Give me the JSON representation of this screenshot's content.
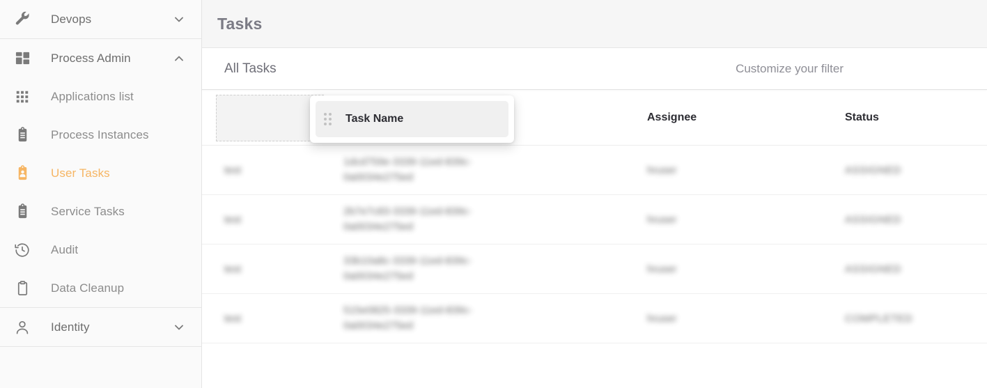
{
  "sidebar": {
    "groups": [
      {
        "label": "Devops",
        "icon": "wrench-icon",
        "expanded": false,
        "chevron": "chevron-down-icon",
        "items": []
      },
      {
        "label": "Process Admin",
        "icon": "dashboard-grid-icon",
        "expanded": true,
        "chevron": "chevron-up-icon",
        "items": [
          {
            "label": "Applications list",
            "icon": "apps-grid-icon",
            "active": false
          },
          {
            "label": "Process Instances",
            "icon": "clipboard-list-icon",
            "active": false
          },
          {
            "label": "User Tasks",
            "icon": "user-task-icon",
            "active": true
          },
          {
            "label": "Service Tasks",
            "icon": "clipboard-list-icon",
            "active": false
          },
          {
            "label": "Audit",
            "icon": "history-clock-icon",
            "active": false
          },
          {
            "label": "Data Cleanup",
            "icon": "clipboard-icon",
            "active": false
          }
        ]
      },
      {
        "label": "Identity",
        "icon": "person-icon",
        "expanded": false,
        "chevron": "chevron-down-icon",
        "items": []
      }
    ]
  },
  "header": {
    "title": "Tasks"
  },
  "filter_bar": {
    "title": "All Tasks",
    "customize_link": "Customize your filter"
  },
  "drag_card": {
    "label": "Task Name",
    "handle_icon": "drag-handle-dots-icon"
  },
  "table": {
    "columns": [
      {
        "key": "dropzone",
        "label": ""
      },
      {
        "key": "name",
        "label": ""
      },
      {
        "key": "assignee",
        "label": "Assignee"
      },
      {
        "key": "status",
        "label": "Status"
      }
    ],
    "rows": [
      {
        "first": "test",
        "name_line1": "1dcd759e-3339-11ed-839c-",
        "name_line2": "0a0034e275ed",
        "assignee": "hruser",
        "status": "ASSIGNED"
      },
      {
        "first": "test",
        "name_line1": "2b7e7c83-3339-11ed-839c-",
        "name_line2": "0a0034e275ed",
        "assignee": "hruser",
        "status": "ASSIGNED"
      },
      {
        "first": "test",
        "name_line1": "33b10a8c-3339-11ed-839c-",
        "name_line2": "0a0034e275ed",
        "assignee": "hruser",
        "status": "ASSIGNED"
      },
      {
        "first": "test",
        "name_line1": "515e0825-3339-11ed-839c-",
        "name_line2": "0a0034e275ed",
        "assignee": "hruser",
        "status": "COMPLETED"
      }
    ]
  },
  "colors": {
    "accent": "#f6b563",
    "sidebar_bg": "#fafafa",
    "header_bg": "#f6f6f6",
    "text_muted": "#8c8c8c"
  }
}
